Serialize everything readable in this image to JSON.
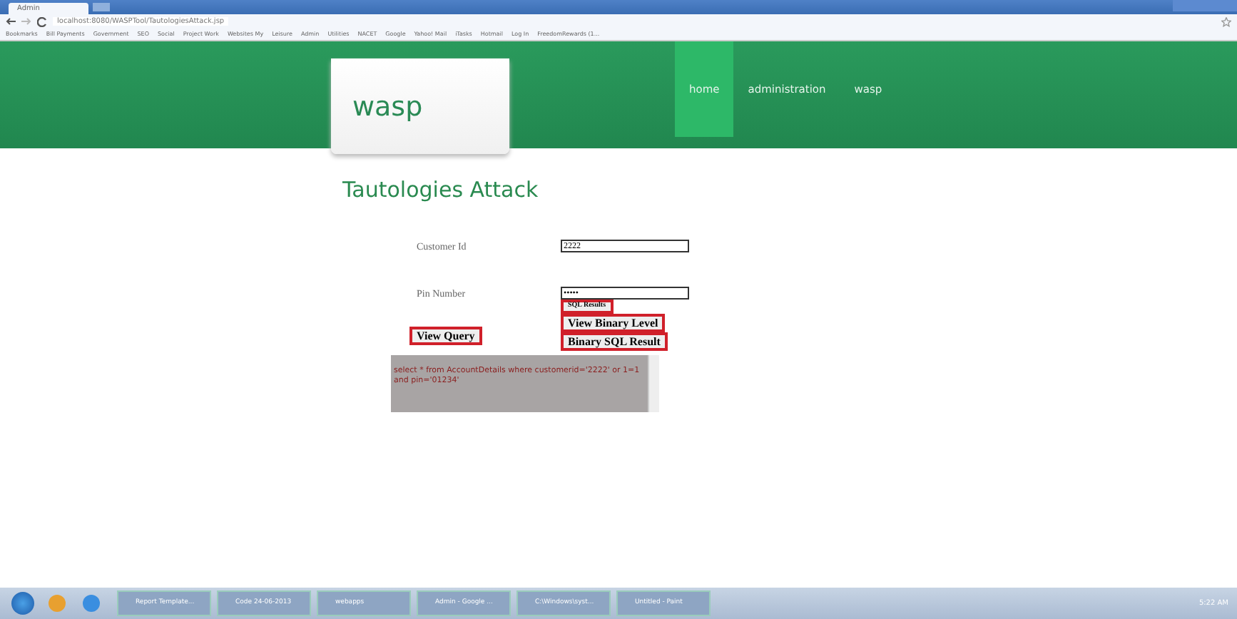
{
  "browser": {
    "tabs": [
      {
        "label": "Admin",
        "selected": true
      }
    ],
    "url": "localhost:8080/WASPTool/TautologiesAttack.jsp",
    "bookmarks": [
      "Bookmarks",
      "Bill Payments",
      "Government",
      "SEO",
      "Social",
      "Project Work",
      "Websites My",
      "Leisure",
      "Admin",
      "Utilities",
      "NACET",
      "Google",
      "Yahoo! Mail",
      "iTasks",
      "Hotmail",
      "Log In",
      "FreedomRewards (1..."
    ]
  },
  "site": {
    "logo": "wasp",
    "nav": [
      {
        "label": "home",
        "selected": true
      },
      {
        "label": "administration",
        "selected": false
      },
      {
        "label": "wasp",
        "selected": false
      }
    ]
  },
  "page": {
    "title": "Tautologies Attack",
    "fields": [
      {
        "label": "Customer Id",
        "value": "2222"
      },
      {
        "label": "Pin Number",
        "value": "•••••"
      }
    ],
    "sql_results_button": "SQL Results",
    "view_query_button": "View Query",
    "view_binary_button": "View Binary Level",
    "binary_result_button": "Binary SQL Result",
    "query_output": "select * from AccountDetails where customerid='2222' or 1=1 and pin='01234'"
  },
  "taskbar": {
    "items": [
      "Report Template...",
      "Code 24-06-2013",
      "webapps",
      "Admin - Google ...",
      "C:\\Windows\\syst...",
      "Untitled - Paint"
    ],
    "clock": "5:22 AM"
  }
}
